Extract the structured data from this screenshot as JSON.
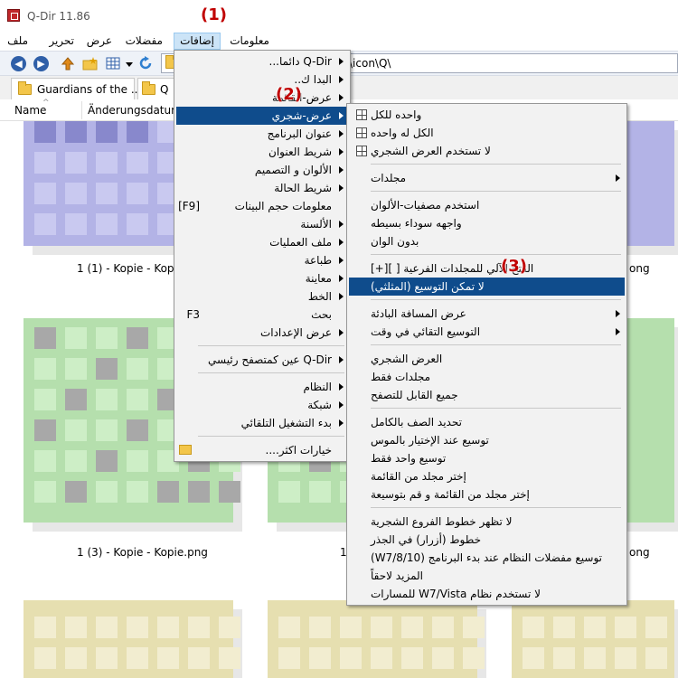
{
  "window": {
    "title": "Q-Dir 11.86"
  },
  "callouts": [
    "(1)",
    "(2)",
    "(3)"
  ],
  "menubar": {
    "items": [
      {
        "label": "ملف"
      },
      {
        "label": "تحرير"
      },
      {
        "label": "عرض"
      },
      {
        "label": "مفضلات"
      },
      {
        "label": "إضافات"
      },
      {
        "label": "معلومات"
      }
    ]
  },
  "address": {
    "value": "\\icon\\Q\\"
  },
  "tabs": [
    {
      "label": "Guardians of the ..."
    },
    {
      "label": "Q"
    }
  ],
  "columns": {
    "name": "Name",
    "date": "Änderungsdatum"
  },
  "files": [
    {
      "label": "1 (1) - Kopie - Kopie."
    },
    {
      "label": "ong"
    },
    {
      "label": "1 (3) - Kopie - Kopie.png"
    },
    {
      "label": "1"
    },
    {
      "label": "ong"
    }
  ],
  "extras_menu": {
    "items": [
      {
        "label": "Q-Dir دائما...",
        "arrow": true
      },
      {
        "label": "البدا ك..",
        "arrow": true
      },
      {
        "label": "عرض-القائمة",
        "arrow": true
      },
      {
        "label": "عرض-شجري",
        "arrow": true,
        "highlighted": true
      },
      {
        "label": "عنوان البرنامج",
        "arrow": true
      },
      {
        "label": "شريط العنوان",
        "arrow": true
      },
      {
        "label": "الألوان و التصميم",
        "arrow": true
      },
      {
        "label": "شريط الحالة",
        "arrow": true
      },
      {
        "label": "معلومات حجم البينات",
        "shortcut": "[F9]"
      },
      {
        "label": "الألسنة",
        "arrow": true
      },
      {
        "label": "ملف العمليات",
        "arrow": true
      },
      {
        "label": "طباعة",
        "arrow": true
      },
      {
        "label": "معاينة",
        "arrow": true
      },
      {
        "label": "الخط",
        "arrow": true
      },
      {
        "label": "بحث",
        "shortcut": "F3"
      },
      {
        "label": "عرض الإعدادات",
        "arrow": true
      },
      {
        "label": "Q-Dir عين كمتصفح رئيسي",
        "arrow": true
      },
      {
        "label": "النظام",
        "arrow": true
      },
      {
        "label": "شبكة",
        "arrow": true
      },
      {
        "label": "بدء التشغيل التلقائي",
        "arrow": true
      },
      {
        "label": "خيارات اكثر...."
      }
    ]
  },
  "tree_menu": {
    "items": [
      {
        "label": "واحده للكل"
      },
      {
        "label": "الكل له واحده"
      },
      {
        "label": "لا تستخدم العرض الشجري"
      },
      {
        "label": "مجلدات",
        "arrow": true
      },
      {
        "label": "استخدم مصفيات-الألوان"
      },
      {
        "label": "واجهه سوداء بسيطه"
      },
      {
        "label": "بدون الوان"
      },
      {
        "label": "الفتح الآلي للمجلدات الفرعية [ ][+]"
      },
      {
        "label": "لا تمكن التوسيع (المثلثي)",
        "highlighted": true
      },
      {
        "label": "عرض المسافة البادئة",
        "arrow": true
      },
      {
        "label": "التوسيع التقائي في وقت",
        "arrow": true
      },
      {
        "label": "العرض الشجري"
      },
      {
        "label": "مجلدات فقط"
      },
      {
        "label": "جميع القابل للتصفح"
      },
      {
        "label": "تحديد الصف بالكامل"
      },
      {
        "label": "توسيع عند الإختيار بالموس"
      },
      {
        "label": "توسيع واحد فقط"
      },
      {
        "label": "إختر مجلد من القائمة"
      },
      {
        "label": "إختر مجلد من القائمة و قم بتوسيعة"
      },
      {
        "label": "لا تظهر خطوط الفروع الشجرية"
      },
      {
        "label": "خطوط (أزرار) في الجذر"
      },
      {
        "label": "توسيع مفضلات النظام عند بدء البرنامج (W7/8/10)"
      },
      {
        "label": "المزيد لاحقاً"
      },
      {
        "label": "لا تستخدم نظام W7/Vista للمسارات"
      }
    ]
  },
  "colors": {
    "purple_bg": "#b3b3e6",
    "green_bg": "#b5dfad",
    "yellow_bg": "#e6dfb0",
    "highlight": "#0f4c8c",
    "callout": "#c00000"
  }
}
